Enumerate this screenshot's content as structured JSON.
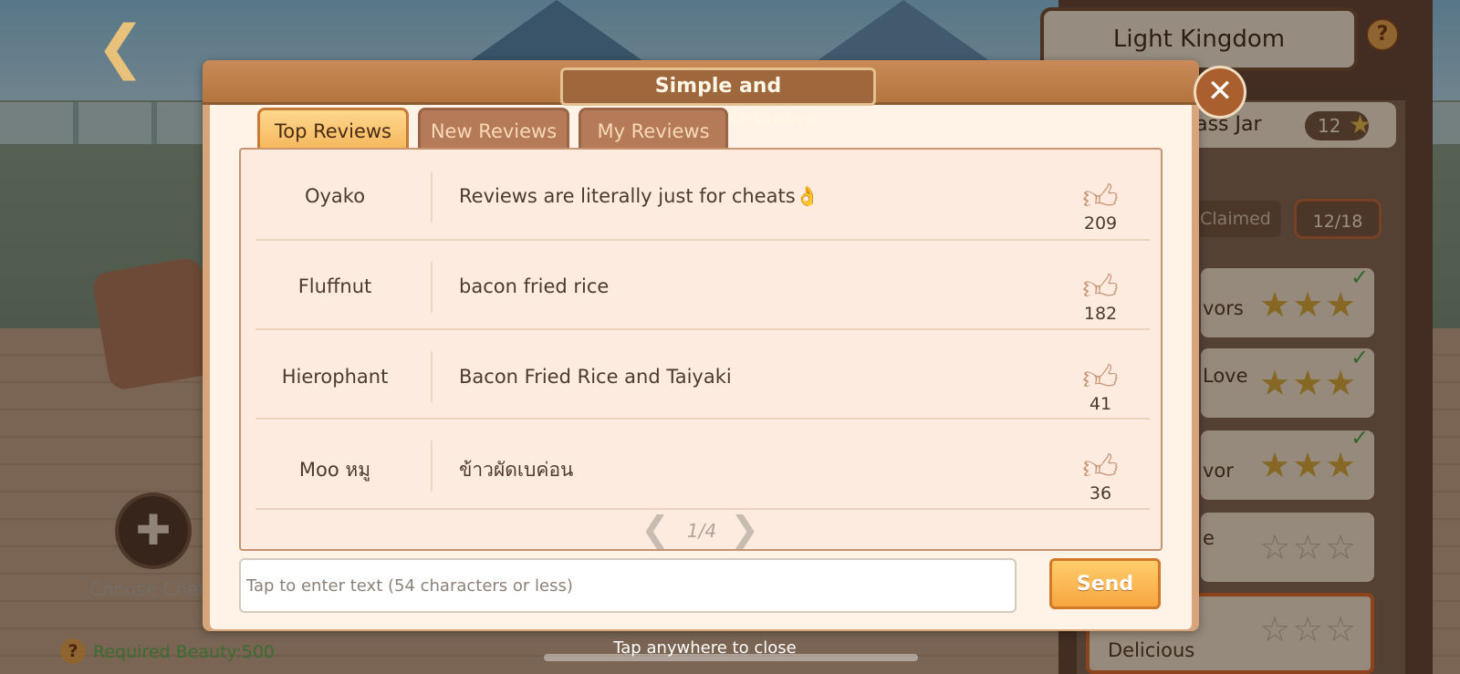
{
  "background": {
    "kingdom_title": "Light Kingdom",
    "jar_label": "lass Jar",
    "jar_count": "12",
    "claimed_label": "Claimed",
    "progress_count": "12/18",
    "tasks": [
      {
        "label": "vors",
        "stars": 3,
        "completed": true
      },
      {
        "label": "Love",
        "stars": 3,
        "completed": true
      },
      {
        "label": "vor",
        "stars": 3,
        "completed": true
      },
      {
        "label": "e",
        "stars": 0,
        "completed": false
      },
      {
        "label": "d\nDelicious",
        "stars": 0,
        "completed": false
      }
    ],
    "choose_chef": "Choose Chef",
    "required_beauty": "Required Beauty:500",
    "close_hint": "Tap anywhere to close"
  },
  "dialog": {
    "title": "Simple and DeliciousReviews",
    "tabs": [
      {
        "label": "Top Reviews",
        "active": true
      },
      {
        "label": "New Reviews",
        "active": false
      },
      {
        "label": "My Reviews",
        "active": false
      }
    ],
    "reviews": [
      {
        "user": "Oyako",
        "text": "Reviews are literally just for cheats👌",
        "likes": "209"
      },
      {
        "user": "Fluffnut",
        "text": "bacon fried rice",
        "likes": "182"
      },
      {
        "user": "Hierophant",
        "text": "Bacon Fried Rice and Taiyaki",
        "likes": "41"
      },
      {
        "user": "Moo หมู",
        "text": "ข้าวผัดเบค่อน",
        "likes": "36"
      }
    ],
    "pager": "1/4",
    "input_placeholder": "Tap to enter text (54 characters or less)",
    "send_label": "Send"
  },
  "icons": {
    "back": "back-arrow-icon",
    "close": "close-icon",
    "help": "help-icon",
    "thumb": "thumbs-up-icon",
    "prev": "chevron-left-icon",
    "next": "chevron-right-icon"
  },
  "colors": {
    "accent": "#f6b95e",
    "dialog_bg": "#fef3e6",
    "send": "#f7a640",
    "required_beauty": "#5fae4f"
  }
}
